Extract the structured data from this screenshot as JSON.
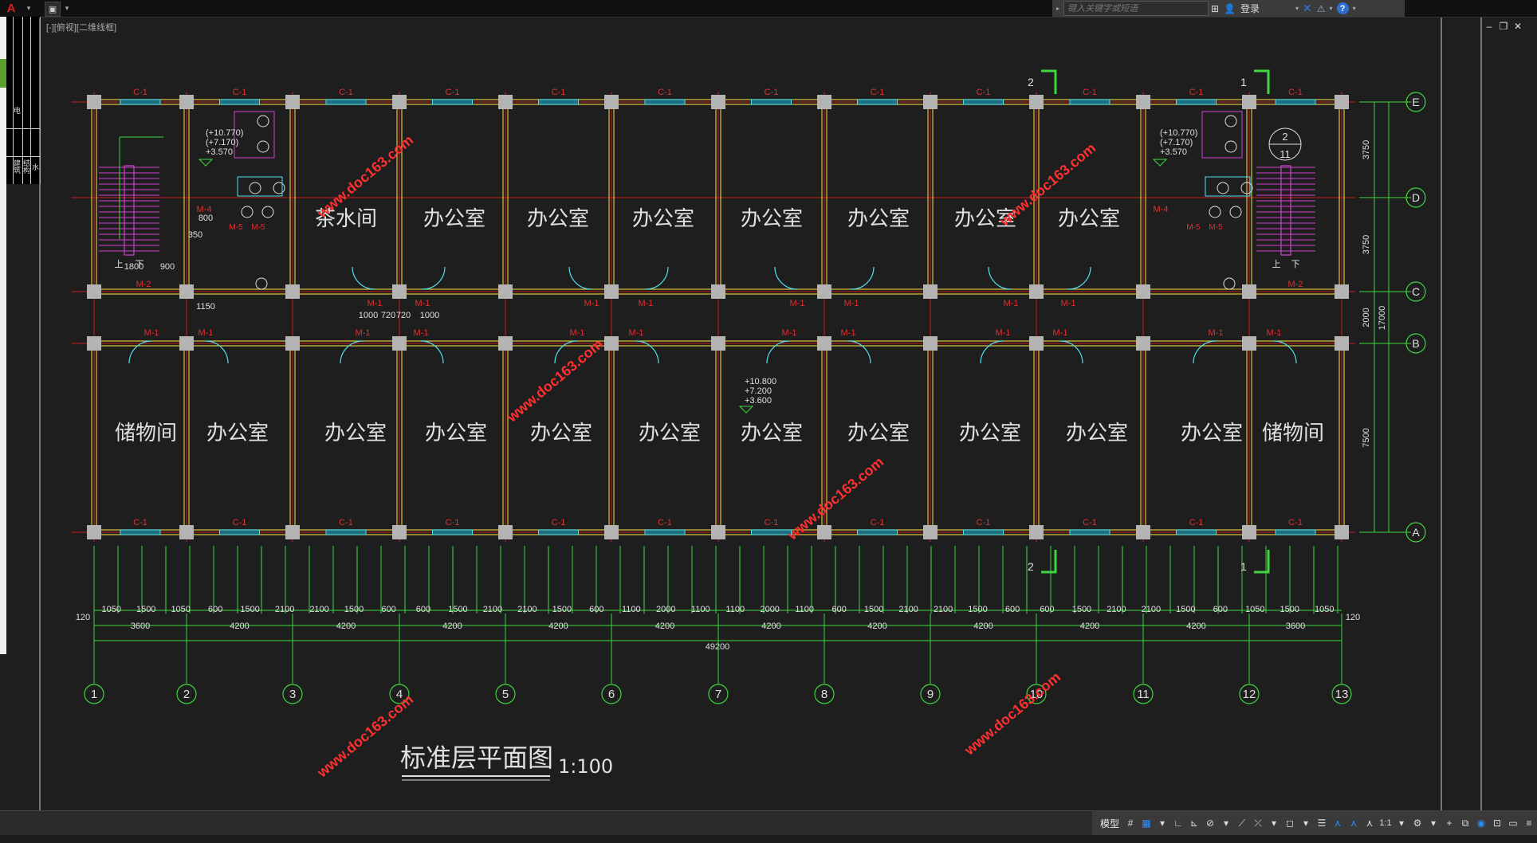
{
  "app": {
    "logo_glyph": "A",
    "viewport_label": "[-][俯视][二维线框]",
    "search_placeholder": "键入关键字或短语",
    "login_label": "登录",
    "help_label": "?",
    "palette_labels": [
      "建筑",
      "结构",
      "水",
      "电"
    ]
  },
  "window_controls": {
    "minimize": "–",
    "restore": "❐",
    "close": "✕"
  },
  "drawing": {
    "title": "标准层平面图",
    "scale": "1:100",
    "watermark": "www.doc163.com",
    "grid_numbers": [
      "1",
      "2",
      "3",
      "4",
      "5",
      "6",
      "7",
      "8",
      "9",
      "10",
      "11",
      "12",
      "13"
    ],
    "grid_letters": [
      "E",
      "D",
      "C",
      "B",
      "A"
    ],
    "right_dims": [
      "3750",
      "3750",
      "2000",
      "7500",
      "17000"
    ],
    "bay_dims": [
      "3600",
      "4200",
      "4200",
      "4200",
      "4200",
      "4200",
      "4200",
      "4200",
      "4200",
      "4200",
      "4200",
      "3600"
    ],
    "total_dim": "49200",
    "end_dim": "120",
    "detail_dims": [
      "1050",
      "1500",
      "1050",
      "600",
      "1500",
      "2100",
      "2100",
      "1500",
      "600",
      "600",
      "1500",
      "2100",
      "2100",
      "1500",
      "600",
      "1100",
      "2000",
      "1100",
      "1100",
      "2000",
      "1100",
      "600",
      "1500",
      "2100",
      "2100",
      "1500",
      "600",
      "600",
      "1500",
      "2100",
      "2100",
      "1500",
      "600",
      "1050",
      "1500",
      "1050"
    ],
    "top_rooms": [
      "茶水间",
      "办公室",
      "办公室",
      "办公室",
      "办公室",
      "办公室",
      "办公室",
      "办公室"
    ],
    "bottom_rooms": [
      "储物间",
      "办公室",
      "办公室",
      "办公室",
      "办公室",
      "办公室",
      "办公室",
      "办公室",
      "办公室",
      "办公室",
      "办公室",
      "储物间"
    ],
    "window_tag": "C-1",
    "door_tag": "M-1",
    "door_tag_m2": "M-2",
    "door_tag_m4": "M-4",
    "door_tag_m5": "M-5",
    "level_wc": [
      "(+10.770)",
      "(+7.170)",
      "+3.570"
    ],
    "level_office": [
      "+10.800",
      "+7.200",
      "+3.600"
    ],
    "stair_dims": [
      "1800",
      "900",
      "800",
      "350",
      "1150"
    ],
    "corridor_dims": [
      "1000",
      "720",
      "720",
      "1000"
    ],
    "stair_up": "上",
    "stair_down": "下",
    "section_1": "1",
    "section_2": "2",
    "detail_callout_top": "2",
    "detail_callout_bottom": "11"
  },
  "statusbar": {
    "model_label": "模型",
    "scale_label": "1:1"
  }
}
